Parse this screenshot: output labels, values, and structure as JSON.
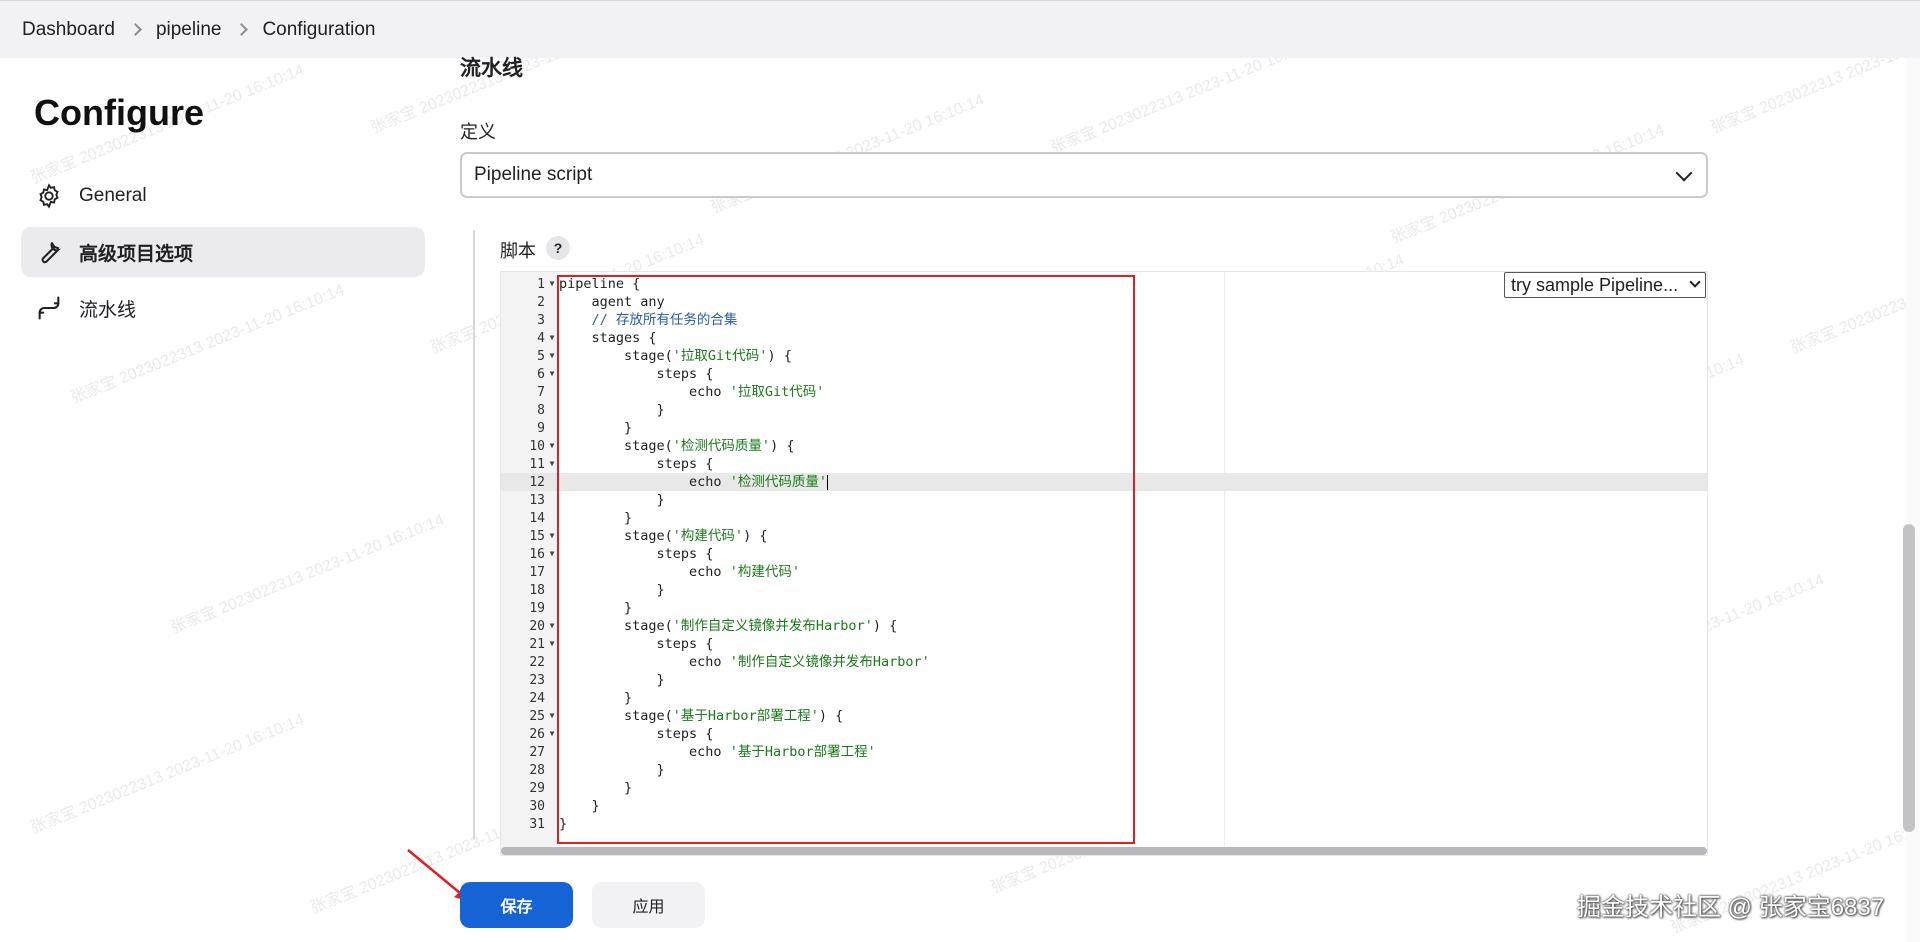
{
  "breadcrumb": [
    "Dashboard",
    "pipeline",
    "Configuration"
  ],
  "sidebar": {
    "title": "Configure",
    "items": [
      {
        "label": "General",
        "icon": "gear-icon"
      },
      {
        "label": "高级项目选项",
        "icon": "wrench-icon",
        "active": true
      },
      {
        "label": "流水线",
        "icon": "pipeline-icon"
      }
    ]
  },
  "main": {
    "section_title": "流水线",
    "definition_label": "定义",
    "definition_value": "Pipeline script",
    "script_label": "脚本",
    "help_label": "?",
    "sample_select": "try sample Pipeline...",
    "active_line": 12,
    "code_lines": [
      "pipeline {",
      "    agent any",
      "    // 存放所有任务的合集",
      "    stages {",
      "        stage('拉取Git代码') {",
      "            steps {",
      "                echo '拉取Git代码'",
      "            }",
      "        }",
      "        stage('检测代码质量') {",
      "            steps {",
      "                echo '检测代码质量'",
      "            }",
      "        }",
      "        stage('构建代码') {",
      "            steps {",
      "                echo '构建代码'",
      "            }",
      "        }",
      "        stage('制作自定义镜像并发布Harbor') {",
      "            steps {",
      "                echo '制作自定义镜像并发布Harbor'",
      "            }",
      "        }",
      "        stage('基于Harbor部署工程') {",
      "            steps {",
      "                echo '基于Harbor部署工程'",
      "            }",
      "        }",
      "    }",
      "}"
    ],
    "fold_lines": [
      1,
      4,
      5,
      6,
      10,
      11,
      15,
      16,
      20,
      21,
      25,
      26
    ]
  },
  "buttons": {
    "save": "保存",
    "apply": "应用"
  },
  "credit": "掘金技术社区 @ 张家宝6837",
  "watermark": "张家宝 2023022313 2023-11-20 16:10:14",
  "colors": {
    "primary": "#1663d6",
    "highlight_box": "#e01e24",
    "string": "#1a7a1a",
    "comment": "#2a5db0"
  }
}
